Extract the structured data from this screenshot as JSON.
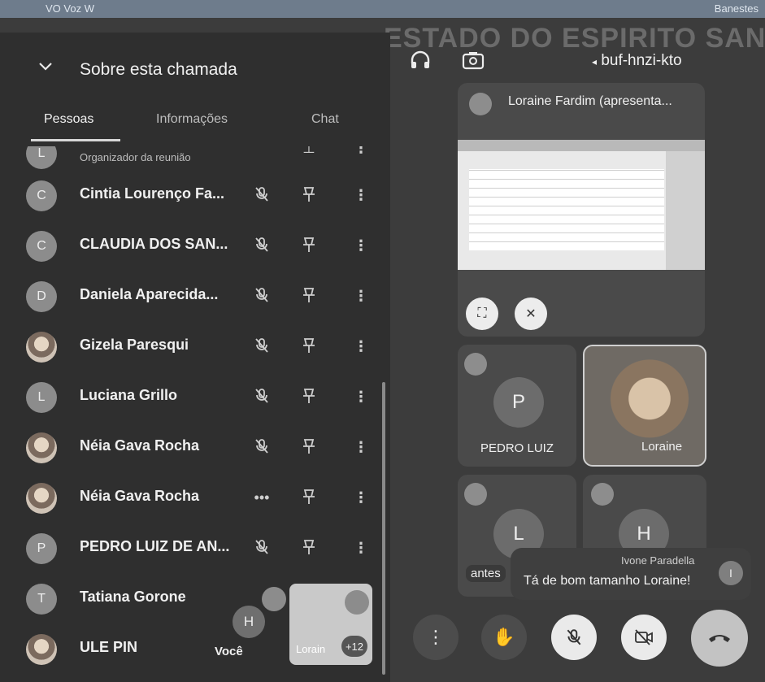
{
  "statusbar": {
    "left": "VO Voz W",
    "right": "Banestes"
  },
  "watermark": "ESTADO DO ESPIRITO SANT",
  "panel": {
    "title": "Sobre esta chamada",
    "tabs": [
      "Pessoas",
      "Informações",
      "Chat"
    ]
  },
  "participants": [
    {
      "initial": "L",
      "name": "",
      "role": "Organizador da reunião",
      "photo": false
    },
    {
      "initial": "C",
      "name": "Cintia Lourenço Fa...",
      "photo": false
    },
    {
      "initial": "C",
      "name": "CLAUDIA DOS SAN...",
      "photo": false
    },
    {
      "initial": "D",
      "name": "Daniela Aparecida...",
      "photo": false
    },
    {
      "initial": "",
      "name": "Gizela Paresqui",
      "photo": true
    },
    {
      "initial": "L",
      "name": "Luciana Grillo",
      "photo": false
    },
    {
      "initial": "",
      "name": "Néia Gava Rocha",
      "photo": true
    },
    {
      "initial": "",
      "name": "Néia Gava Rocha",
      "photo": true,
      "speaking": true
    },
    {
      "initial": "P",
      "name": "PEDRO LUIZ DE AN...",
      "photo": false
    },
    {
      "initial": "T",
      "name": "Tatiana Gorone",
      "photo": false
    },
    {
      "initial": "",
      "name": "ULE PIN",
      "photo": true
    }
  ],
  "icons": {
    "mic_off": "mic-off-icon",
    "pin": "pin-icon",
    "more": "more-vert-icon",
    "speaking": "speaking-dots-icon"
  },
  "self_tile": {
    "initial": "H",
    "label": "Você"
  },
  "thumb": {
    "label": "Lorain",
    "more_count": "+12"
  },
  "meeting_code": "buf-hnzi-kto",
  "main_tile": {
    "title": "Loraine Fardim (apresenta..."
  },
  "tiles": [
    {
      "name": "PEDRO LUIZ",
      "initial": "P"
    },
    {
      "name": "Loraine",
      "initial": ""
    },
    {
      "name": "antes",
      "initial": "L"
    },
    {
      "name": "",
      "initial": "H"
    }
  ],
  "toast": {
    "who": "Ivone Paradella",
    "initial": "I",
    "message": "Tá de bom tamanho Loraine!"
  },
  "controls": [
    "more-vert-icon",
    "raise-hand-icon",
    "mic-off-icon",
    "camera-off-icon",
    "end-call-icon"
  ]
}
